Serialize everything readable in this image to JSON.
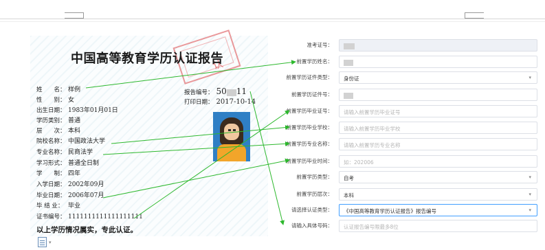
{
  "report": {
    "title": "中国高等教育学历认证报告",
    "stamp": "认",
    "left_fields": [
      {
        "k": "姓　　名：",
        "v": "样例"
      },
      {
        "k": "性　　别：",
        "v": "女"
      },
      {
        "k": "出生日期：",
        "v": "1983年01月01日"
      },
      {
        "k": "学历类别：",
        "v": "普通"
      },
      {
        "k": "层　　次：",
        "v": "本科"
      },
      {
        "k": "院校名称：",
        "v": "中国政法大学"
      },
      {
        "k": "专业名称：",
        "v": "民商法学"
      },
      {
        "k": "学习形式：",
        "v": "普通全日制"
      },
      {
        "k": "学　　制：",
        "v": "四年"
      },
      {
        "k": "入学日期：",
        "v": "2002年09月"
      },
      {
        "k": "毕业日期：",
        "v": "2006年07月"
      },
      {
        "k": "毕 结 业：",
        "v": "毕业"
      },
      {
        "k": "证书编号：",
        "v": "1111111111111111111"
      }
    ],
    "report_no_label": "报告编号：",
    "report_no_prefix": "50",
    "report_no_suffix": "11",
    "print_date_label": "打印日期：",
    "print_date": "2017-10-14",
    "footer": "以上学历情况属实，专此认证。"
  },
  "form": {
    "rows": [
      {
        "label": "准考证号：",
        "value": "",
        "placeholder": "",
        "type": "masked-disabled"
      },
      {
        "label": "前置学历姓名：",
        "value": "",
        "placeholder": "",
        "type": "masked"
      },
      {
        "label": "前置学历证件类型：",
        "value": "身份证",
        "placeholder": "",
        "type": "select"
      },
      {
        "label": "前置学历证件号：",
        "value": "",
        "placeholder": "",
        "type": "masked"
      },
      {
        "label": "前置学历毕业证号：",
        "value": "",
        "placeholder": "请输入前置学历毕业证号",
        "type": "input"
      },
      {
        "label": "前置学历毕业学校：",
        "value": "",
        "placeholder": "请输入前置学历毕业学校",
        "type": "input"
      },
      {
        "label": "前置学历专业名称：",
        "value": "",
        "placeholder": "请输入前置学历专业名称",
        "type": "input"
      },
      {
        "label": "前置学历毕业时间：",
        "value": "",
        "placeholder": "如：202006",
        "type": "input"
      },
      {
        "label": "前置学历类型：",
        "value": "自考",
        "placeholder": "",
        "type": "select"
      },
      {
        "label": "前置学历层次：",
        "value": "本科",
        "placeholder": "",
        "type": "select"
      },
      {
        "label": "请选择认证类型：",
        "value": "《中国高等教育学历认证报告》报告编号",
        "placeholder": "",
        "type": "select-active"
      },
      {
        "label": "请输入具体号码：",
        "value": "",
        "placeholder": "认证报告编号限最多8位",
        "type": "input"
      }
    ],
    "caret": "▾"
  },
  "colors": {
    "arrow": "#2db82d",
    "accent": "#409eff",
    "stamp": "#e57f82"
  },
  "icons": {
    "doc": "document-icon",
    "caret": "▾"
  }
}
